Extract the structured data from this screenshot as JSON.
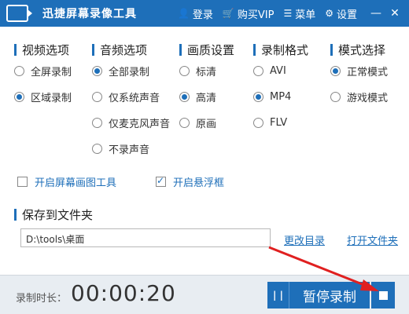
{
  "app": {
    "title": "迅捷屏幕录像工具"
  },
  "topbar": {
    "login": "登录",
    "buy_vip": "购买VIP",
    "menu": "菜单",
    "settings": "设置",
    "minimize": "—",
    "close": "✕"
  },
  "sections": {
    "video": {
      "title": "视频选项",
      "options": [
        "全屏录制",
        "区域录制"
      ]
    },
    "audio": {
      "title": "音频选项",
      "options": [
        "全部录制",
        "仅系统声音",
        "仅麦克风声音",
        "不录声音"
      ]
    },
    "quality": {
      "title": "画质设置",
      "options": [
        "标清",
        "高清",
        "原画"
      ]
    },
    "format": {
      "title": "录制格式",
      "options": [
        "AVI",
        "MP4",
        "FLV"
      ]
    },
    "mode": {
      "title": "模式选择",
      "options": [
        "正常模式",
        "游戏模式"
      ]
    }
  },
  "checkboxes": {
    "drawing_tool": "开启屏幕画图工具",
    "float_window": "开启悬浮框"
  },
  "folder": {
    "title": "保存到文件夹",
    "path": "D:\\tools\\桌面",
    "change_dir": "更改目录",
    "open_folder": "打开文件夹"
  },
  "bottom": {
    "duration_label": "录制时长：",
    "timer": "00:00:20",
    "pause_label": "暂停录制",
    "pause_icon": "| |"
  },
  "colors": {
    "accent": "#1e6fb9",
    "arrow": "#e02020"
  }
}
